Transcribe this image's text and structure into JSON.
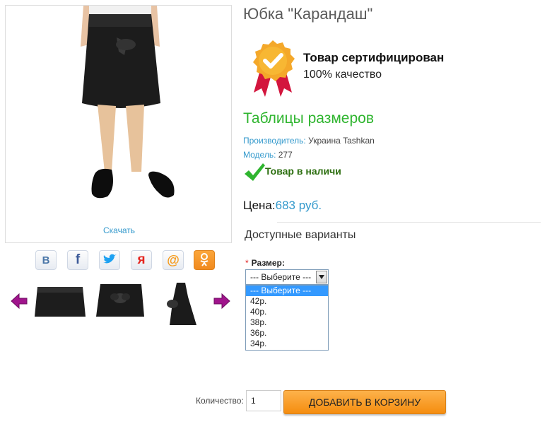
{
  "product": {
    "title": "Юбка \"Карандаш\"",
    "download_label": "Скачать"
  },
  "certificate": {
    "title": "Товар сертифицирован",
    "subtitle": "100% качество",
    "icon": "certificate-badge-icon"
  },
  "size_table_link": "Таблицы размеров",
  "manufacturer": {
    "label": "Производитель:",
    "value": "Украина Tashkan"
  },
  "model": {
    "label": "Модель:",
    "value": "277"
  },
  "stock_status": "Товар в наличи",
  "price": {
    "label": "Цена:",
    "value": "683 руб."
  },
  "options": {
    "title": "Доступные варианты",
    "size_label": "Размер:",
    "required_mark": "*",
    "selected": "--- Выберите ---",
    "list": [
      "--- Выберите ---",
      "42р.",
      "40р.",
      "38р.",
      "36р.",
      "34р."
    ]
  },
  "social": [
    {
      "name": "vk",
      "glyph": "B",
      "color": "#4a76a8"
    },
    {
      "name": "facebook",
      "glyph": "f",
      "color": "#3b5998"
    },
    {
      "name": "twitter",
      "glyph": "t",
      "color": "#1da1f2"
    },
    {
      "name": "yandex",
      "glyph": "я",
      "color": "#e52620"
    },
    {
      "name": "mail",
      "glyph": "@",
      "color": "#f59a1b"
    },
    {
      "name": "odnoklassniki",
      "glyph": "ок",
      "color": "#f18a1e"
    }
  ],
  "cart": {
    "quantity_label": "Количество:",
    "quantity_value": "1",
    "add_button": "ДОБАВИТЬ В КОРЗИНУ"
  },
  "colors": {
    "link": "#3399cc",
    "green": "#2fb52f",
    "button": "#f7931e",
    "arrow": "#a0148c"
  }
}
